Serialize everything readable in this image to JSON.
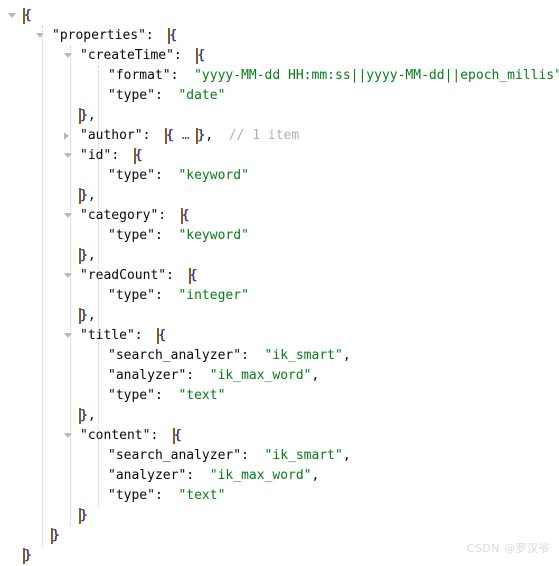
{
  "editor": {
    "language": "json",
    "background_color": "#ffffff",
    "text_color": "#080808",
    "string_color": "#067d17",
    "comment_color": "#b0b0b0",
    "brace_color": "#3b3b8f",
    "guide_color": "#c9c9c9",
    "fold_marker_color": "#b8b8b8",
    "line_height_px": 20,
    "font_size_px": 13
  },
  "lines": [
    {
      "n": 1,
      "indent": 0,
      "fold": "expanded",
      "text": "{"
    },
    {
      "n": 2,
      "indent": 1,
      "fold": "expanded",
      "key": "\"properties\"",
      "colon": ":",
      "text": "{"
    },
    {
      "n": 3,
      "indent": 2,
      "fold": "expanded",
      "key": "\"createTime\"",
      "colon": ":",
      "text": "{"
    },
    {
      "n": 4,
      "indent": 3,
      "fold": "none",
      "key": "\"format\"",
      "colon": ":",
      "value": "\"yyyy-MM-dd HH:mm:ss||yyyy-MM-dd||epoch_millis\"",
      "comma": ","
    },
    {
      "n": 5,
      "indent": 3,
      "fold": "none",
      "key": "\"type\"",
      "colon": ":",
      "value": "\"date\""
    },
    {
      "n": 6,
      "indent": 2,
      "fold": "none",
      "text": "},"
    },
    {
      "n": 7,
      "indent": 2,
      "fold": "collapsed",
      "key": "\"author\"",
      "colon": ":",
      "collapsed_body": "{ … },",
      "comment": "// 1 item"
    },
    {
      "n": 8,
      "indent": 2,
      "fold": "expanded",
      "key": "\"id\"",
      "colon": ":",
      "text": "{"
    },
    {
      "n": 9,
      "indent": 3,
      "fold": "none",
      "key": "\"type\"",
      "colon": ":",
      "value": "\"keyword\""
    },
    {
      "n": 10,
      "indent": 2,
      "fold": "none",
      "text": "},"
    },
    {
      "n": 11,
      "indent": 2,
      "fold": "expanded",
      "key": "\"category\"",
      "colon": ":",
      "text": "{"
    },
    {
      "n": 12,
      "indent": 3,
      "fold": "none",
      "key": "\"type\"",
      "colon": ":",
      "value": "\"keyword\""
    },
    {
      "n": 13,
      "indent": 2,
      "fold": "none",
      "text": "},"
    },
    {
      "n": 14,
      "indent": 2,
      "fold": "expanded",
      "key": "\"readCount\"",
      "colon": ":",
      "text": "{"
    },
    {
      "n": 15,
      "indent": 3,
      "fold": "none",
      "key": "\"type\"",
      "colon": ":",
      "value": "\"integer\""
    },
    {
      "n": 16,
      "indent": 2,
      "fold": "none",
      "text": "},"
    },
    {
      "n": 17,
      "indent": 2,
      "fold": "expanded",
      "key": "\"title\"",
      "colon": ":",
      "text": "{"
    },
    {
      "n": 18,
      "indent": 3,
      "fold": "none",
      "key": "\"search_analyzer\"",
      "colon": ":",
      "value": "\"ik_smart\"",
      "comma": ","
    },
    {
      "n": 19,
      "indent": 3,
      "fold": "none",
      "key": "\"analyzer\"",
      "colon": ":",
      "value": "\"ik_max_word\"",
      "comma": ","
    },
    {
      "n": 20,
      "indent": 3,
      "fold": "none",
      "key": "\"type\"",
      "colon": ":",
      "value": "\"text\""
    },
    {
      "n": 21,
      "indent": 2,
      "fold": "none",
      "text": "},"
    },
    {
      "n": 22,
      "indent": 2,
      "fold": "expanded",
      "key": "\"content\"",
      "colon": ":",
      "text": "{"
    },
    {
      "n": 23,
      "indent": 3,
      "fold": "none",
      "key": "\"search_analyzer\"",
      "colon": ":",
      "value": "\"ik_smart\"",
      "comma": ","
    },
    {
      "n": 24,
      "indent": 3,
      "fold": "none",
      "key": "\"analyzer\"",
      "colon": ":",
      "value": "\"ik_max_word\"",
      "comma": ","
    },
    {
      "n": 25,
      "indent": 3,
      "fold": "none",
      "key": "\"type\"",
      "colon": ":",
      "value": "\"text\""
    },
    {
      "n": 26,
      "indent": 2,
      "fold": "none",
      "text": "}"
    },
    {
      "n": 27,
      "indent": 1,
      "fold": "none",
      "text": "}"
    },
    {
      "n": 28,
      "indent": 0,
      "fold": "none",
      "text": "}"
    }
  ],
  "watermark": {
    "text": "CSDN @罗汉爷"
  }
}
